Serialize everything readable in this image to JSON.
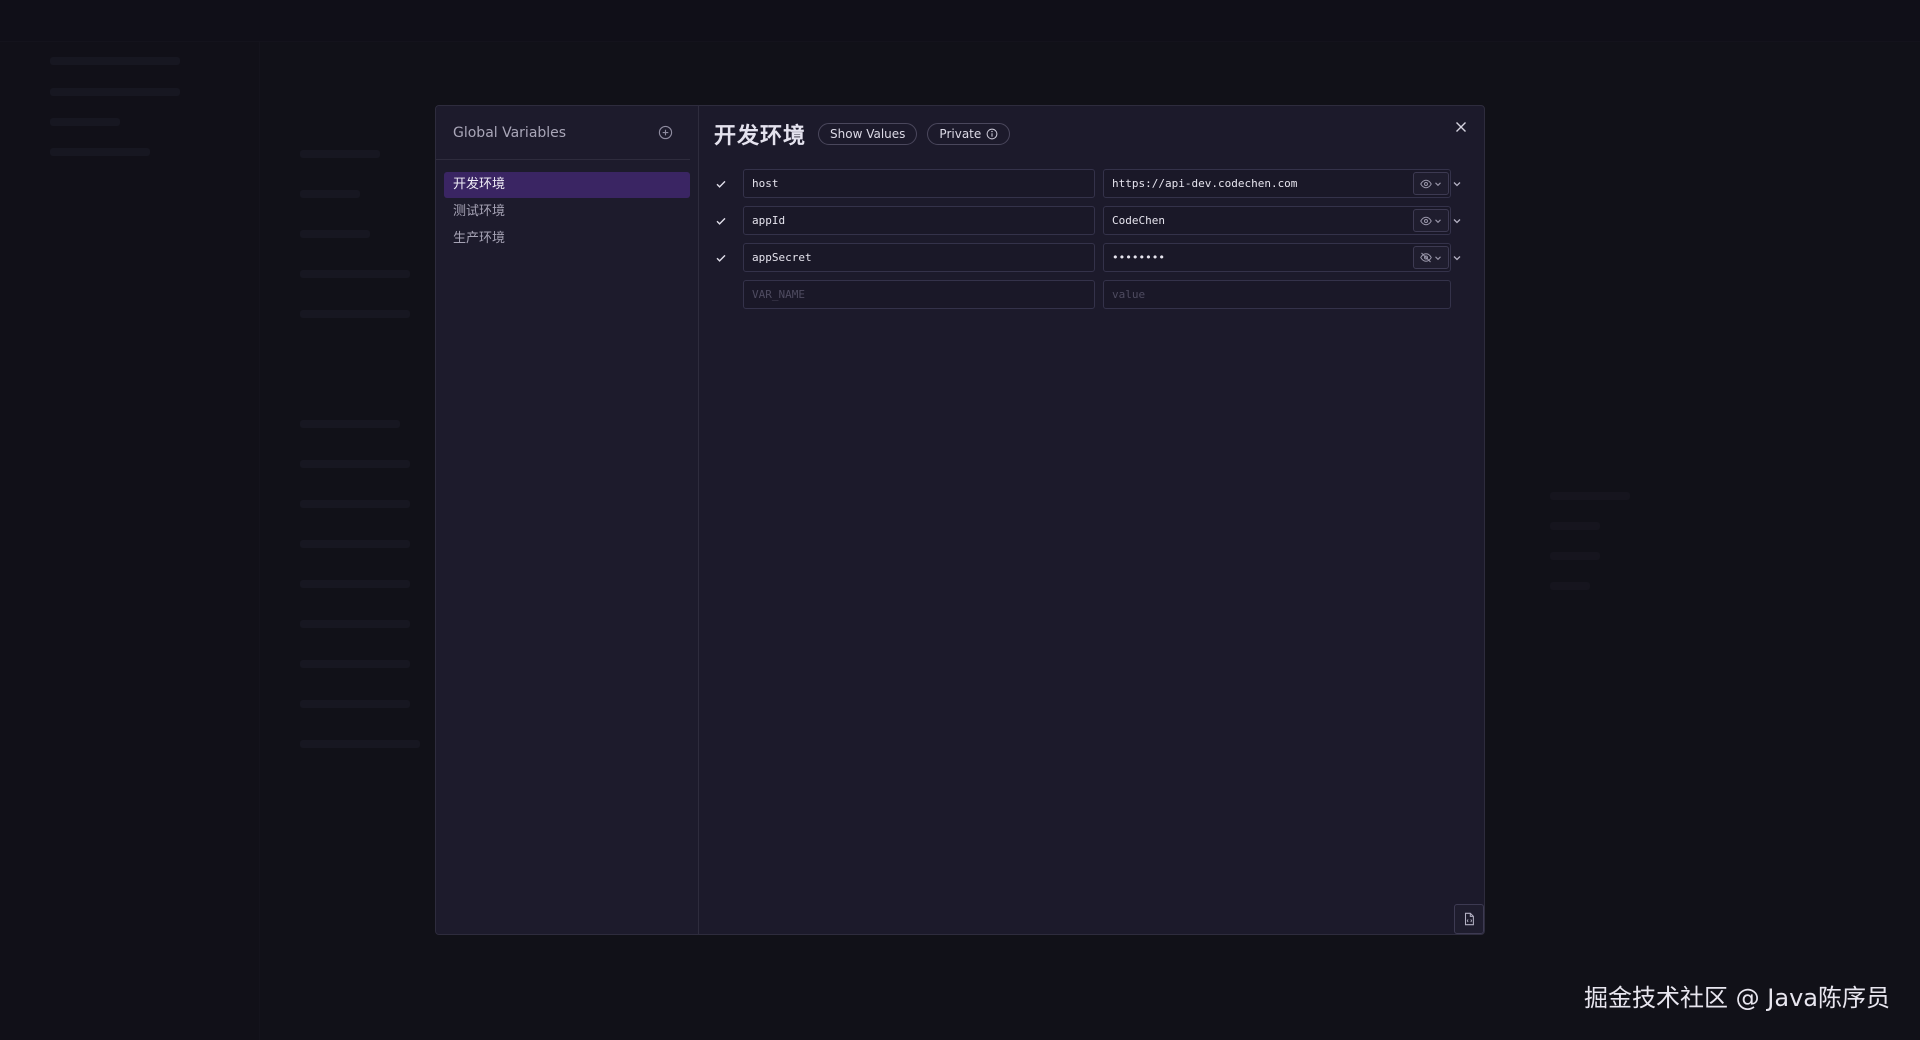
{
  "sidebar": {
    "title": "Global Variables",
    "environments": [
      {
        "label": "开发环境",
        "active": true
      },
      {
        "label": "测试环境",
        "active": false
      },
      {
        "label": "生产环境",
        "active": false
      }
    ]
  },
  "main": {
    "env_title": "开发环境",
    "show_values_label": "Show Values",
    "private_label": "Private"
  },
  "variables": [
    {
      "name": "host",
      "value": "https://api-dev.codechen.com",
      "visible": true,
      "enabled": true
    },
    {
      "name": "appId",
      "value": "CodeChen",
      "visible": true,
      "enabled": true
    },
    {
      "name": "appSecret",
      "value": "••••••••",
      "visible": false,
      "enabled": true
    }
  ],
  "new_variable": {
    "name_placeholder": "VAR_NAME",
    "value_placeholder": "value"
  },
  "watermark": "掘金技术社区 @ Java陈序员",
  "colors": {
    "accent_active": "#3a2563",
    "dialog_bg": "#1c1a2b",
    "border": "#2e2c3d"
  }
}
